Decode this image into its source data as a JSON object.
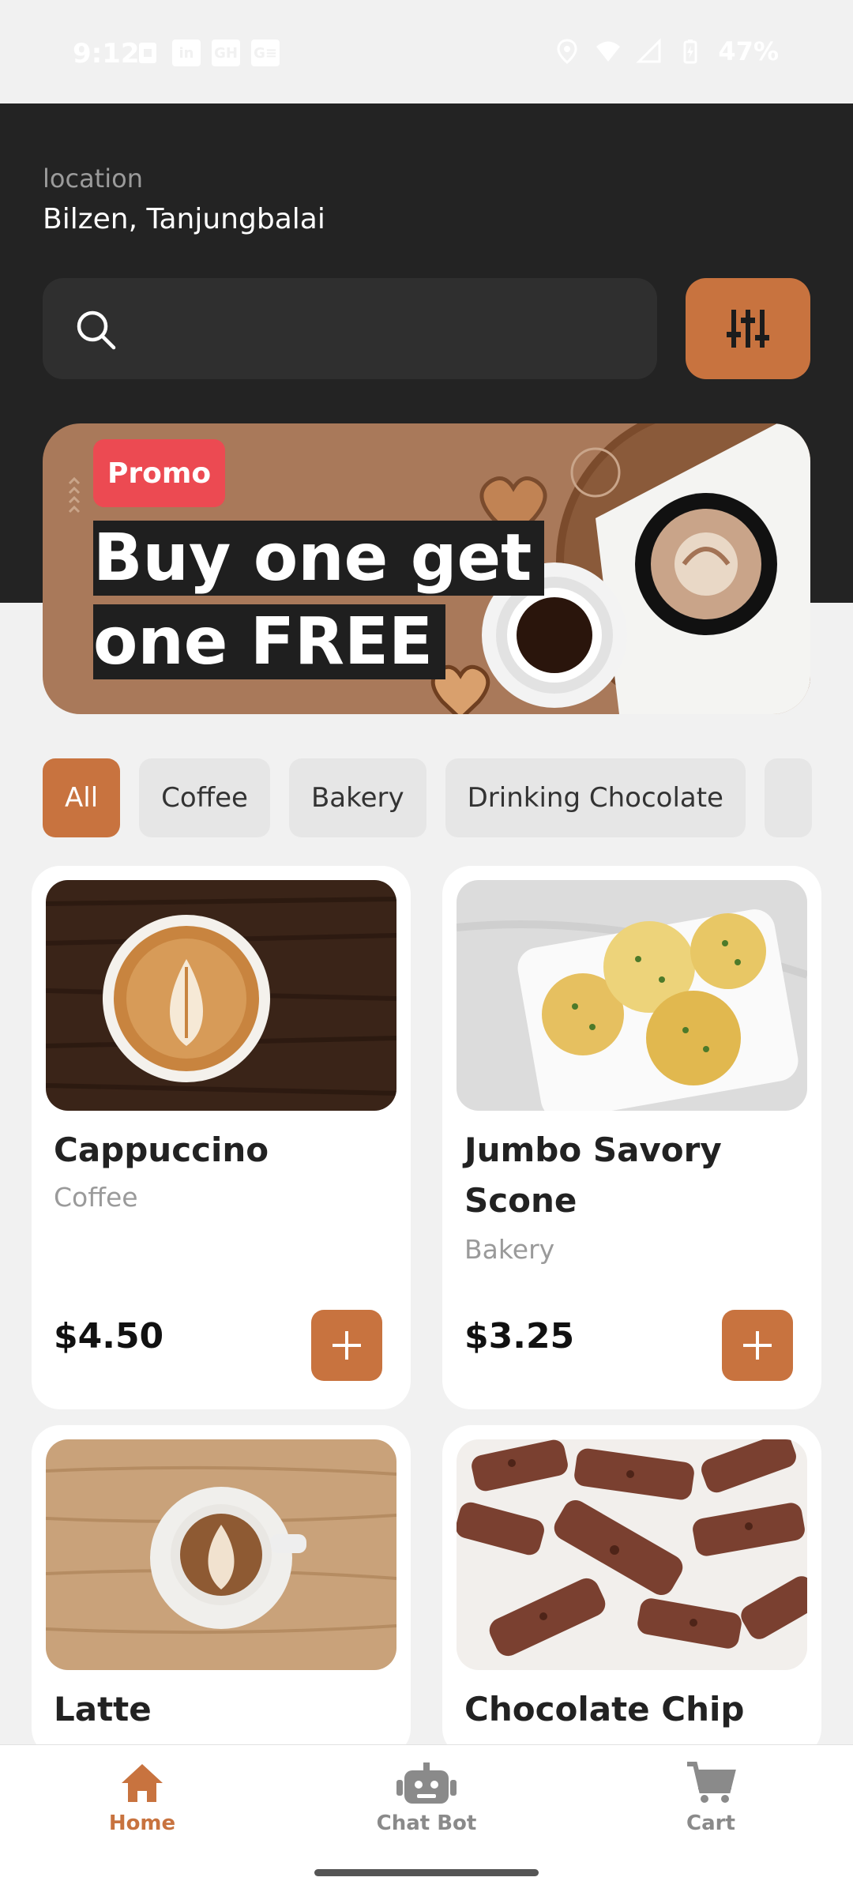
{
  "status_bar": {
    "time": "9:12",
    "battery": "47%",
    "icons": [
      "sim-icon",
      "linkedin-icon",
      "github-icon",
      "gmail-icon",
      "location-icon",
      "wifi-icon",
      "signal-icon",
      "battery-icon"
    ],
    "mini_labels": [
      "in",
      "GH",
      "G≡"
    ]
  },
  "header": {
    "location_label": "location",
    "location_value": "Bilzen, Tanjungbalai",
    "search_placeholder": ""
  },
  "promo": {
    "badge": "Promo",
    "title_line1": "Buy one get",
    "title_line2": "one FREE"
  },
  "categories": [
    "All",
    "Coffee",
    "Bakery",
    "Drinking Chocolate"
  ],
  "products": [
    {
      "name": "Cappuccino",
      "category": "Coffee",
      "price": "$4.50"
    },
    {
      "name": "Jumbo Savory Scone",
      "category": "Bakery",
      "price": "$3.25"
    },
    {
      "name": "Latte",
      "category": "",
      "price": ""
    },
    {
      "name": "Chocolate Chip",
      "category": "",
      "price": ""
    }
  ],
  "nav": {
    "home": "Home",
    "chatbot": "Chat Bot",
    "cart": "Cart"
  },
  "colors": {
    "accent": "#c8733f",
    "header_bg": "#232323",
    "promo_badge": "#ec4a52",
    "background": "#f1f1f1"
  }
}
